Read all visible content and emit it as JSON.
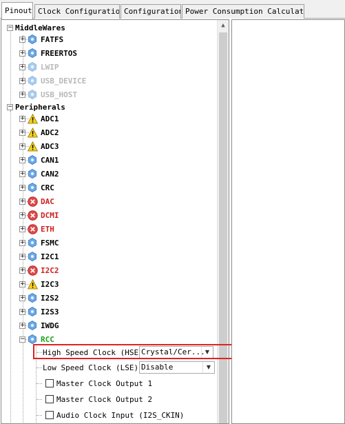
{
  "tabs": [
    {
      "label": "Pinout",
      "active": true
    },
    {
      "label": "Clock Configuration",
      "active": false
    },
    {
      "label": "Configuration",
      "active": false
    },
    {
      "label": "Power Consumption Calculator",
      "active": false
    }
  ],
  "tree": {
    "middlewares": {
      "label": "MiddleWares",
      "expander": "−",
      "items": [
        {
          "label": "FATFS",
          "icon": "gear-icon",
          "state": "normal"
        },
        {
          "label": "FREERTOS",
          "icon": "gear-icon",
          "state": "normal"
        },
        {
          "label": "LWIP",
          "icon": "gear-icon",
          "state": "disabled"
        },
        {
          "label": "USB_DEVICE",
          "icon": "gear-icon",
          "state": "disabled"
        },
        {
          "label": "USB_HOST",
          "icon": "gear-icon",
          "state": "disabled"
        }
      ]
    },
    "peripherals": {
      "label": "Peripherals",
      "expander": "−",
      "items": [
        {
          "label": "ADC1",
          "icon": "warning-icon",
          "state": "warning"
        },
        {
          "label": "ADC2",
          "icon": "warning-icon",
          "state": "warning"
        },
        {
          "label": "ADC3",
          "icon": "warning-icon",
          "state": "warning"
        },
        {
          "label": "CAN1",
          "icon": "gear-icon",
          "state": "normal"
        },
        {
          "label": "CAN2",
          "icon": "gear-icon",
          "state": "normal"
        },
        {
          "label": "CRC",
          "icon": "gear-icon",
          "state": "normal"
        },
        {
          "label": "DAC",
          "icon": "error-icon",
          "state": "error"
        },
        {
          "label": "DCMI",
          "icon": "error-icon",
          "state": "error"
        },
        {
          "label": "ETH",
          "icon": "error-icon",
          "state": "error"
        },
        {
          "label": "FSMC",
          "icon": "gear-icon",
          "state": "normal"
        },
        {
          "label": "I2C1",
          "icon": "gear-icon",
          "state": "normal"
        },
        {
          "label": "I2C2",
          "icon": "error-icon",
          "state": "error"
        },
        {
          "label": "I2C3",
          "icon": "warning-icon",
          "state": "warning"
        },
        {
          "label": "I2S2",
          "icon": "gear-icon",
          "state": "normal"
        },
        {
          "label": "I2S3",
          "icon": "gear-icon",
          "state": "normal"
        },
        {
          "label": "IWDG",
          "icon": "gear-icon",
          "state": "normal"
        },
        {
          "label": "RCC",
          "icon": "gear-icon",
          "state": "enabled",
          "expander": "−"
        }
      ]
    },
    "rcc": {
      "hse_label": "High Speed Clock (HSE)",
      "hse_value": "Crystal/Cer...",
      "lse_label": "Low Speed Clock (LSE)",
      "lse_value": "Disable",
      "mco1_label": "Master Clock Output 1",
      "mco2_label": "Master Clock Output 2",
      "i2s_label": "Audio Clock Input (I2S_CKIN)"
    }
  },
  "colors": {
    "warning": "#f7d21a",
    "error": "#e04a4a",
    "gear": "#4a90d9",
    "enabled_text": "#1e9e1e",
    "error_text": "#d02020",
    "highlight": "#e02020"
  }
}
